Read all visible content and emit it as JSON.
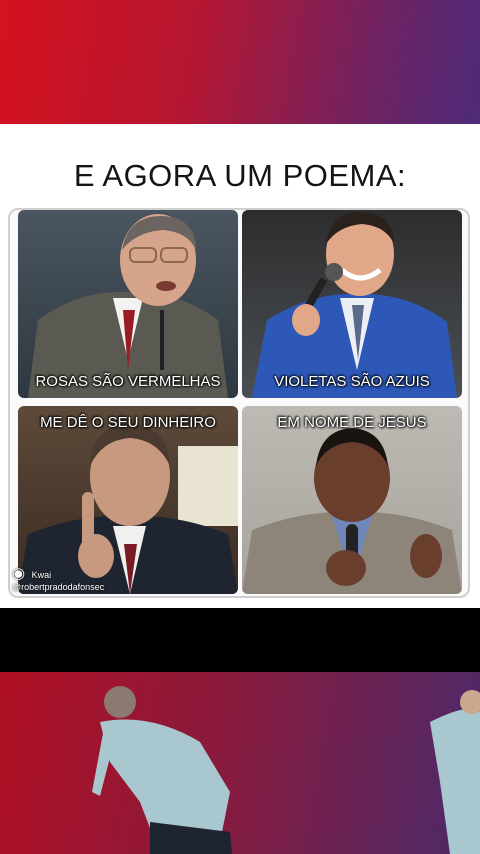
{
  "meme": {
    "title": "E AGORA UM POEMA:",
    "panels": [
      {
        "caption": "ROSAS SÃO VERMELHAS"
      },
      {
        "caption": "VIOLETAS SÃO AZUIS"
      },
      {
        "caption": "ME DÊ O SEU DINHEIRO"
      },
      {
        "caption": "EM NOME DE JESUS"
      }
    ]
  },
  "watermark": {
    "app": "Kwai",
    "handle": "@robertpradodafonsec"
  }
}
